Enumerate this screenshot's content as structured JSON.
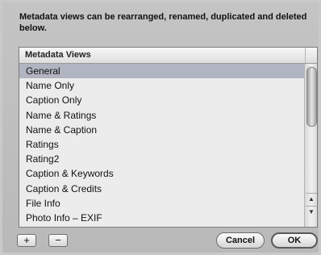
{
  "dialog": {
    "description": "Metadata views can be rearranged, renamed, duplicated and deleted below."
  },
  "list": {
    "header": "Metadata Views",
    "items": [
      {
        "label": "General",
        "selected": true
      },
      {
        "label": "Name Only",
        "selected": false
      },
      {
        "label": "Caption Only",
        "selected": false
      },
      {
        "label": "Name & Ratings",
        "selected": false
      },
      {
        "label": "Name & Caption",
        "selected": false
      },
      {
        "label": "Ratings",
        "selected": false
      },
      {
        "label": "Rating2",
        "selected": false
      },
      {
        "label": "Caption & Keywords",
        "selected": false
      },
      {
        "label": "Caption & Credits",
        "selected": false
      },
      {
        "label": "File Info",
        "selected": false
      },
      {
        "label": "Photo Info – EXIF",
        "selected": false
      }
    ]
  },
  "buttons": {
    "add": "+",
    "remove": "−",
    "cancel": "Cancel",
    "ok": "OK"
  },
  "scroll": {
    "up_icon": "▲",
    "down_icon": "▼"
  },
  "colors": {
    "selection": "#b1b5c1",
    "dialog_background": "#bdbdbd"
  }
}
